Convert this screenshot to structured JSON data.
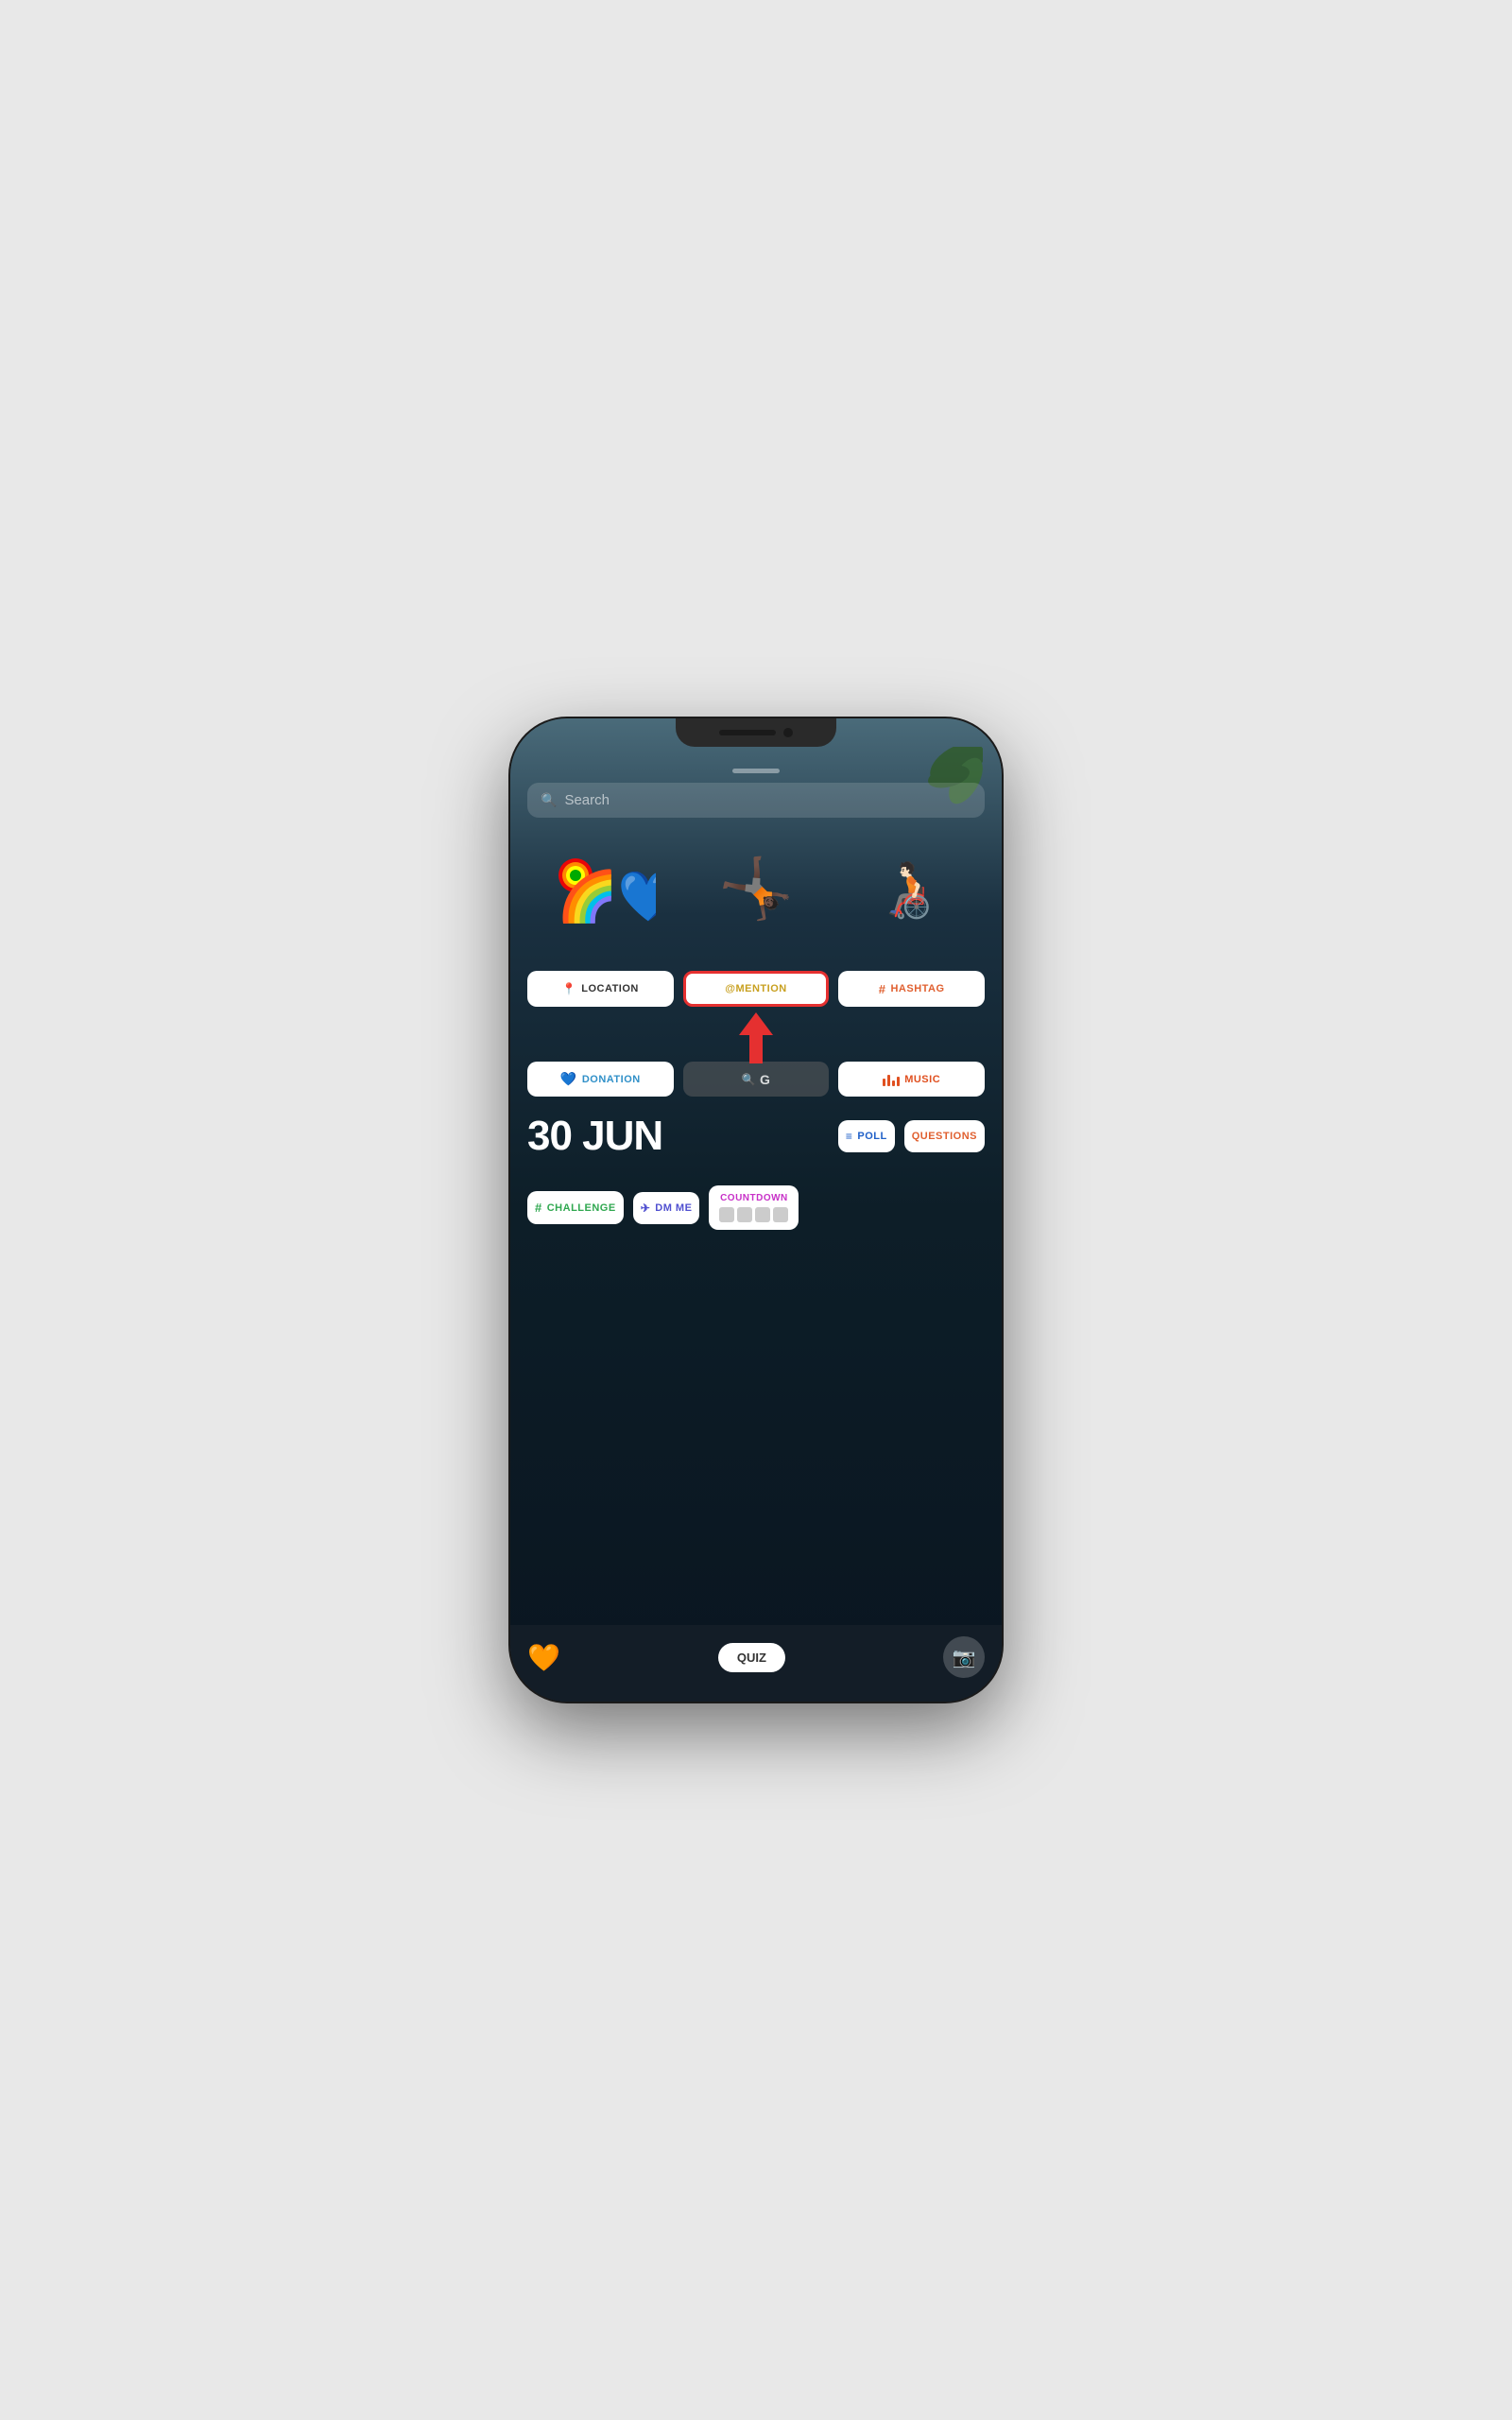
{
  "phone": {
    "notch": {
      "speaker_label": "speaker",
      "camera_label": "camera"
    }
  },
  "search": {
    "placeholder": "Search"
  },
  "stickers": {
    "top_row": [
      {
        "id": "pride-sticker",
        "emoji": "🏳️‍🌈💙🏳️‍⚧️",
        "label": "pride characters"
      },
      {
        "id": "dive-sticker",
        "emoji": "🤸",
        "label": "diving person"
      },
      {
        "id": "wheelchair-sticker",
        "emoji": "👨‍🦽",
        "label": "person in wheelchair"
      }
    ]
  },
  "buttons": {
    "location": {
      "icon": "📍",
      "label": "LOCATION"
    },
    "mention": {
      "icon": "@",
      "label": "@MENTION",
      "highlighted": true
    },
    "hashtag": {
      "icon": "#",
      "label": "HASHTAG"
    },
    "donation": {
      "icon": "♥",
      "label": "DONATION"
    },
    "search_g": {
      "icon": "🔍",
      "label": "G"
    },
    "music": {
      "label": "MUSIC"
    },
    "poll": {
      "icon": "≡",
      "label": "POLL"
    },
    "questions": {
      "label": "QUESTIONS"
    },
    "challenge": {
      "icon": "#",
      "label": "CHALLENGE"
    },
    "dm_me": {
      "icon": "✈",
      "label": "DM ME"
    },
    "countdown": {
      "label": "COUNTDOWN"
    }
  },
  "date": {
    "display": "30 JUN"
  },
  "bottom_nav": {
    "quiz_label": "QUIZ",
    "emoji": "🧡"
  }
}
